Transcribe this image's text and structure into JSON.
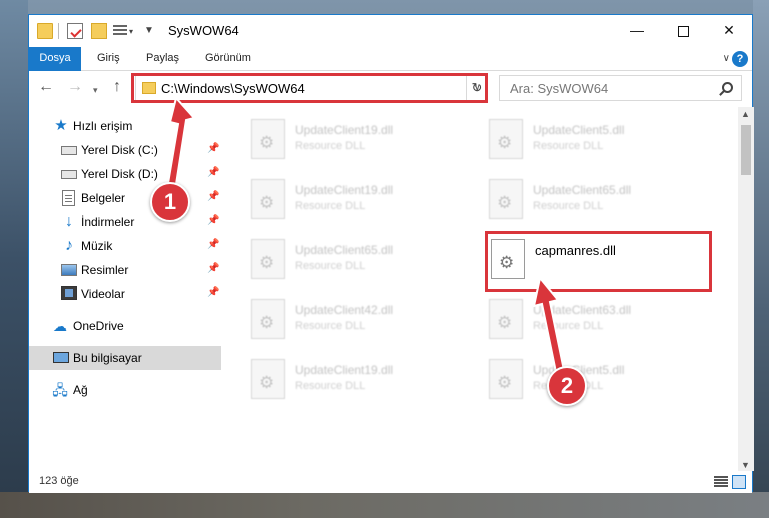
{
  "window": {
    "title": "SysWOW64",
    "minimize_glyph": "—",
    "close_glyph": "✕"
  },
  "ribbon": {
    "tabs": [
      "Dosya",
      "Giriş",
      "Paylaş",
      "Görünüm"
    ],
    "help_glyph": "?"
  },
  "nav": {
    "address": "C:\\Windows\\SysWOW64",
    "search_placeholder": "Ara: SysWOW64"
  },
  "sidebar": {
    "items": [
      {
        "label": "Hızlı erişim",
        "icon": "star-icon",
        "pinned": false
      },
      {
        "label": "Yerel Disk (C:)",
        "icon": "drive-icon",
        "pinned": true
      },
      {
        "label": "Yerel Disk (D:)",
        "icon": "drive-icon",
        "pinned": true
      },
      {
        "label": "Belgeler",
        "icon": "documents-icon",
        "pinned": true
      },
      {
        "label": "İndirmeler",
        "icon": "downloads-icon",
        "pinned": true
      },
      {
        "label": "Müzik",
        "icon": "music-icon",
        "pinned": true
      },
      {
        "label": "Resimler",
        "icon": "pictures-icon",
        "pinned": true
      },
      {
        "label": "Videolar",
        "icon": "videos-icon",
        "pinned": true
      },
      {
        "label": "OneDrive",
        "icon": "onedrive-icon",
        "pinned": false
      },
      {
        "label": "Bu bilgisayar",
        "icon": "this-pc-icon",
        "pinned": false,
        "selected": true
      },
      {
        "label": "Ağ",
        "icon": "network-icon",
        "pinned": false
      }
    ]
  },
  "files": [
    {
      "name": "UpdateClient19.dll",
      "type": "Resource DLL",
      "blurred": true
    },
    {
      "name": "UpdateClient5.dll",
      "type": "Resource DLL",
      "blurred": true
    },
    {
      "name": "UpdateClient19.dll",
      "type": "Resource DLL",
      "blurred": true
    },
    {
      "name": "UpdateClient65.dll",
      "type": "Resource DLL",
      "blurred": true
    },
    {
      "name": "UpdateClient65.dll",
      "type": "Resource DLL",
      "blurred": true
    },
    {
      "name": "capmanres.dll",
      "type": "",
      "blurred": false
    },
    {
      "name": "UpdateClient42.dll",
      "type": "Resource DLL",
      "blurred": true
    },
    {
      "name": "UpdateClient63.dll",
      "type": "Resource DLL",
      "blurred": true
    },
    {
      "name": "UpdateClient19.dll",
      "type": "Resource DLL",
      "blurred": true
    },
    {
      "name": "UpdateClient5.dll",
      "type": "Resource DLL",
      "blurred": true
    }
  ],
  "status": {
    "item_count": "123 öğe"
  },
  "annotations": {
    "badge_1": "1",
    "badge_2": "2",
    "highlight_color": "#d9353b"
  },
  "colors": {
    "accent": "#1979ca"
  }
}
